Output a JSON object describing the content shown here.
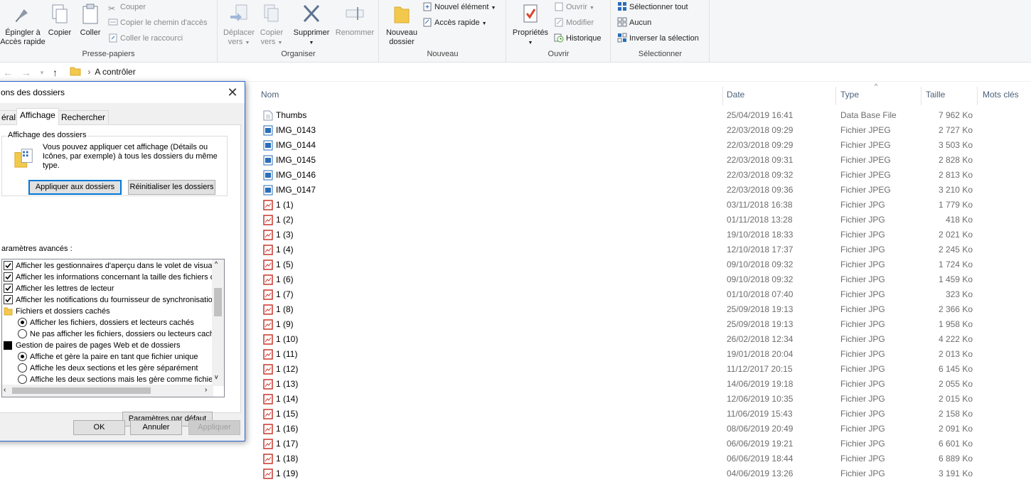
{
  "ribbon": {
    "clipboard": {
      "label": "Presse-papiers",
      "pin_line1": "Épingler à",
      "pin_line2": "Accès rapide",
      "copy": "Copier",
      "paste": "Coller",
      "cut": "Couper",
      "copy_path": "Copier le chemin d'accès",
      "paste_shortcut": "Coller le raccourci"
    },
    "organize": {
      "label": "Organiser",
      "move_line1": "Déplacer",
      "move_line2": "vers",
      "copyto_line1": "Copier",
      "copyto_line2": "vers",
      "delete": "Supprimer",
      "rename": "Renommer"
    },
    "new": {
      "label": "Nouveau",
      "folder_line1": "Nouveau",
      "folder_line2": "dossier",
      "new_item": "Nouvel élément",
      "quick_access": "Accès rapide"
    },
    "open": {
      "label": "Ouvrir",
      "properties": "Propriétés",
      "open": "Ouvrir",
      "edit": "Modifier",
      "history": "Historique"
    },
    "select": {
      "label": "Sélectionner",
      "select_all": "Sélectionner tout",
      "select_none": "Aucun",
      "invert": "Inverser la sélection"
    }
  },
  "address": {
    "path": "A contrôler"
  },
  "columns": {
    "name": "Nom",
    "date": "Date",
    "type": "Type",
    "size": "Taille",
    "tags": "Mots clés"
  },
  "files": [
    {
      "name": "Thumbs",
      "date": "25/04/2019 16:41",
      "type": "Data Base File",
      "size": "7 962 Ko",
      "icon": "db"
    },
    {
      "name": "IMG_0143",
      "date": "22/03/2018 09:29",
      "type": "Fichier JPEG",
      "size": "2 727 Ko",
      "icon": "jpeg"
    },
    {
      "name": "IMG_0144",
      "date": "22/03/2018 09:29",
      "type": "Fichier JPEG",
      "size": "3 503 Ko",
      "icon": "jpeg"
    },
    {
      "name": "IMG_0145",
      "date": "22/03/2018 09:31",
      "type": "Fichier JPEG",
      "size": "2 828 Ko",
      "icon": "jpeg"
    },
    {
      "name": "IMG_0146",
      "date": "22/03/2018 09:32",
      "type": "Fichier JPEG",
      "size": "2 813 Ko",
      "icon": "jpeg"
    },
    {
      "name": "IMG_0147",
      "date": "22/03/2018 09:36",
      "type": "Fichier JPEG",
      "size": "3 210 Ko",
      "icon": "jpeg"
    },
    {
      "name": "1 (1)",
      "date": "03/11/2018 16:38",
      "type": "Fichier JPG",
      "size": "1 779 Ko",
      "icon": "jpg"
    },
    {
      "name": "1 (2)",
      "date": "01/11/2018 13:28",
      "type": "Fichier JPG",
      "size": "418 Ko",
      "icon": "jpg"
    },
    {
      "name": "1 (3)",
      "date": "19/10/2018 18:33",
      "type": "Fichier JPG",
      "size": "2 021 Ko",
      "icon": "jpg"
    },
    {
      "name": "1 (4)",
      "date": "12/10/2018 17:37",
      "type": "Fichier JPG",
      "size": "2 245 Ko",
      "icon": "jpg"
    },
    {
      "name": "1 (5)",
      "date": "09/10/2018 09:32",
      "type": "Fichier JPG",
      "size": "1 724 Ko",
      "icon": "jpg"
    },
    {
      "name": "1 (6)",
      "date": "09/10/2018 09:32",
      "type": "Fichier JPG",
      "size": "1 459 Ko",
      "icon": "jpg"
    },
    {
      "name": "1 (7)",
      "date": "01/10/2018 07:40",
      "type": "Fichier JPG",
      "size": "323 Ko",
      "icon": "jpg"
    },
    {
      "name": "1 (8)",
      "date": "25/09/2018 19:13",
      "type": "Fichier JPG",
      "size": "2 366 Ko",
      "icon": "jpg"
    },
    {
      "name": "1 (9)",
      "date": "25/09/2018 19:13",
      "type": "Fichier JPG",
      "size": "1 958 Ko",
      "icon": "jpg"
    },
    {
      "name": "1 (10)",
      "date": "26/02/2018 12:34",
      "type": "Fichier JPG",
      "size": "4 222 Ko",
      "icon": "jpg"
    },
    {
      "name": "1 (11)",
      "date": "19/01/2018 20:04",
      "type": "Fichier JPG",
      "size": "2 013 Ko",
      "icon": "jpg"
    },
    {
      "name": "1 (12)",
      "date": "11/12/2017 20:15",
      "type": "Fichier JPG",
      "size": "6 145 Ko",
      "icon": "jpg"
    },
    {
      "name": "1 (13)",
      "date": "14/06/2019 19:18",
      "type": "Fichier JPG",
      "size": "2 055 Ko",
      "icon": "jpg"
    },
    {
      "name": "1 (14)",
      "date": "12/06/2019 10:35",
      "type": "Fichier JPG",
      "size": "2 015 Ko",
      "icon": "jpg"
    },
    {
      "name": "1 (15)",
      "date": "11/06/2019 15:43",
      "type": "Fichier JPG",
      "size": "2 158 Ko",
      "icon": "jpg"
    },
    {
      "name": "1 (16)",
      "date": "08/06/2019 20:49",
      "type": "Fichier JPG",
      "size": "2 091 Ko",
      "icon": "jpg"
    },
    {
      "name": "1 (17)",
      "date": "06/06/2019 19:21",
      "type": "Fichier JPG",
      "size": "6 601 Ko",
      "icon": "jpg"
    },
    {
      "name": "1 (18)",
      "date": "06/06/2019 18:44",
      "type": "Fichier JPG",
      "size": "6 889 Ko",
      "icon": "jpg"
    },
    {
      "name": "1 (19)",
      "date": "04/06/2019 13:26",
      "type": "Fichier JPG",
      "size": "3 191 Ko",
      "icon": "jpg"
    }
  ],
  "dialog": {
    "title": "ons des dossiers",
    "tabs": [
      "éral",
      "Affichage",
      "Rechercher"
    ],
    "folder_view_legend": "Affichage des dossiers",
    "folder_view_text1": "Vous pouvez appliquer cet affichage (Détails ou",
    "folder_view_text2": "Icônes, par exemple) à tous les dossiers du même",
    "folder_view_text3": "type.",
    "apply_to_folders": "Appliquer aux dossiers",
    "reset_folders": "Réinitialiser les dossiers",
    "advanced_label": "aramètres avancés :",
    "advanced_items": [
      {
        "kind": "check",
        "checked": true,
        "indent": 0,
        "label": "Afficher les gestionnaires d'aperçu dans le volet de visual"
      },
      {
        "kind": "check",
        "checked": true,
        "indent": 0,
        "label": "Afficher les informations concernant la taille des fichiers da"
      },
      {
        "kind": "check",
        "checked": true,
        "indent": 0,
        "label": "Afficher les lettres de lecteur"
      },
      {
        "kind": "check",
        "checked": true,
        "indent": 0,
        "label": "Afficher les notifications du fournisseur de synchronisation"
      },
      {
        "kind": "folder",
        "checked": false,
        "indent": 0,
        "label": "Fichiers et dossiers cachés"
      },
      {
        "kind": "radio",
        "checked": true,
        "indent": 1,
        "label": "Afficher les fichiers, dossiers et lecteurs cachés"
      },
      {
        "kind": "radio",
        "checked": false,
        "indent": 1,
        "label": "Ne pas afficher les fichiers, dossiers ou lecteurs cach"
      },
      {
        "kind": "block",
        "checked": false,
        "indent": 0,
        "label": "Gestion de paires de pages Web et de dossiers"
      },
      {
        "kind": "radio",
        "checked": true,
        "indent": 1,
        "label": "Affiche et gère la paire en tant que fichier unique"
      },
      {
        "kind": "radio",
        "checked": false,
        "indent": 1,
        "label": "Affiche les deux sections et les gère séparément"
      },
      {
        "kind": "radio",
        "checked": false,
        "indent": 1,
        "label": "Affiche les deux sections mais les gère comme fichier"
      }
    ],
    "defaults_button": "Paramètres par défaut",
    "ok": "OK",
    "cancel": "Annuler",
    "apply": "Appliquer"
  },
  "colors": {
    "accent": "#0078d7",
    "header_text": "#4c607a",
    "jpg_icon": "#c8372e",
    "jpeg_icon": "#2a6db8"
  }
}
